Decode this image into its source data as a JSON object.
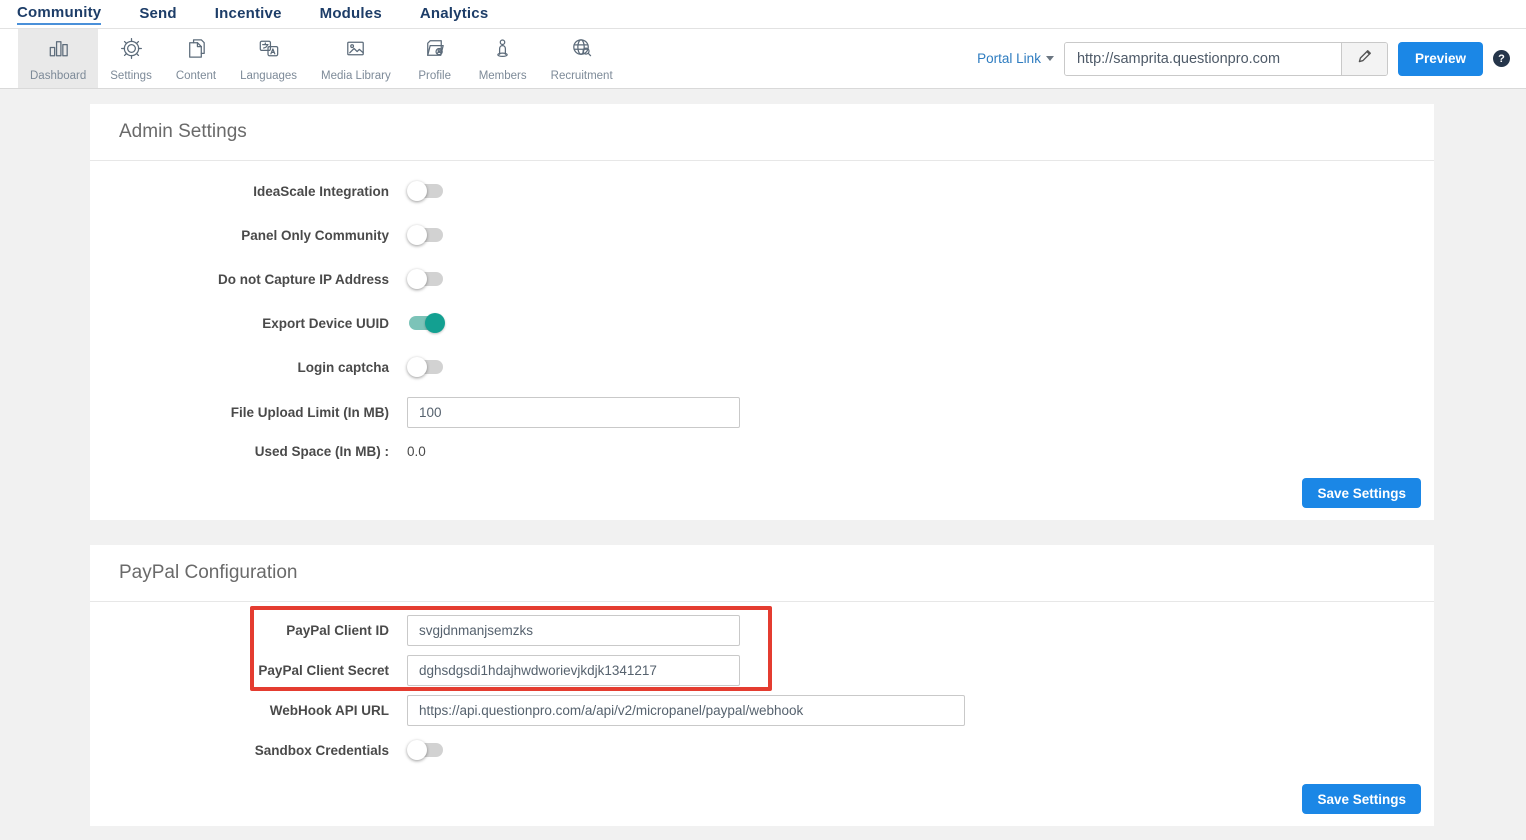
{
  "nav": {
    "items": [
      {
        "label": "Community",
        "active": true
      },
      {
        "label": "Send",
        "active": false
      },
      {
        "label": "Incentive",
        "active": false
      },
      {
        "label": "Modules",
        "active": false
      },
      {
        "label": "Analytics",
        "active": false
      }
    ]
  },
  "toolbar": {
    "tabs": [
      {
        "label": "Dashboard",
        "icon": "bar-chart-icon",
        "active": true
      },
      {
        "label": "Settings",
        "icon": "gear-icon",
        "active": false
      },
      {
        "label": "Content",
        "icon": "pages-icon",
        "active": false
      },
      {
        "label": "Languages",
        "icon": "translate-icon",
        "active": false
      },
      {
        "label": "Media Library",
        "icon": "image-icon",
        "active": false
      },
      {
        "label": "Profile",
        "icon": "folder-person-icon",
        "active": false
      },
      {
        "label": "Members",
        "icon": "person-icon",
        "active": false
      },
      {
        "label": "Recruitment",
        "icon": "globe-search-icon",
        "active": false
      }
    ],
    "portal_link_label": "Portal Link",
    "portal_url": "http://samprita.questionpro.com",
    "preview_label": "Preview",
    "help_glyph": "?"
  },
  "admin_settings": {
    "title": "Admin Settings",
    "toggles": [
      {
        "label": "IdeaScale Integration",
        "on": false
      },
      {
        "label": "Panel Only Community",
        "on": false
      },
      {
        "label": "Do not Capture IP Address",
        "on": false
      },
      {
        "label": "Export Device UUID",
        "on": true
      },
      {
        "label": "Login captcha",
        "on": false
      }
    ],
    "file_upload_limit": {
      "label": "File Upload Limit (In MB)",
      "value": "100"
    },
    "used_space": {
      "label": "Used Space (In MB) :",
      "value": "0.0"
    },
    "save_label": "Save Settings"
  },
  "paypal": {
    "title": "PayPal Configuration",
    "client_id": {
      "label": "PayPal Client ID",
      "value": "svgjdnmanjsemzks"
    },
    "client_secret": {
      "label": "PayPal Client Secret",
      "value": "dghsdgsdi1hdajhwdworievjkdjk1341217"
    },
    "webhook": {
      "label": "WebHook API URL",
      "value": "https://api.questionpro.com/a/api/v2/micropanel/paypal/webhook"
    },
    "sandbox": {
      "label": "Sandbox Credentials",
      "on": false
    },
    "save_label": "Save Settings"
  },
  "colors": {
    "accent_blue": "#1b87e6",
    "toggle_on_knob": "#13a091",
    "toggle_on_track": "#7cc3b8",
    "annotation_red": "#e43c30",
    "nav_text": "#1d3d68",
    "page_background": "#f1f1f1"
  }
}
